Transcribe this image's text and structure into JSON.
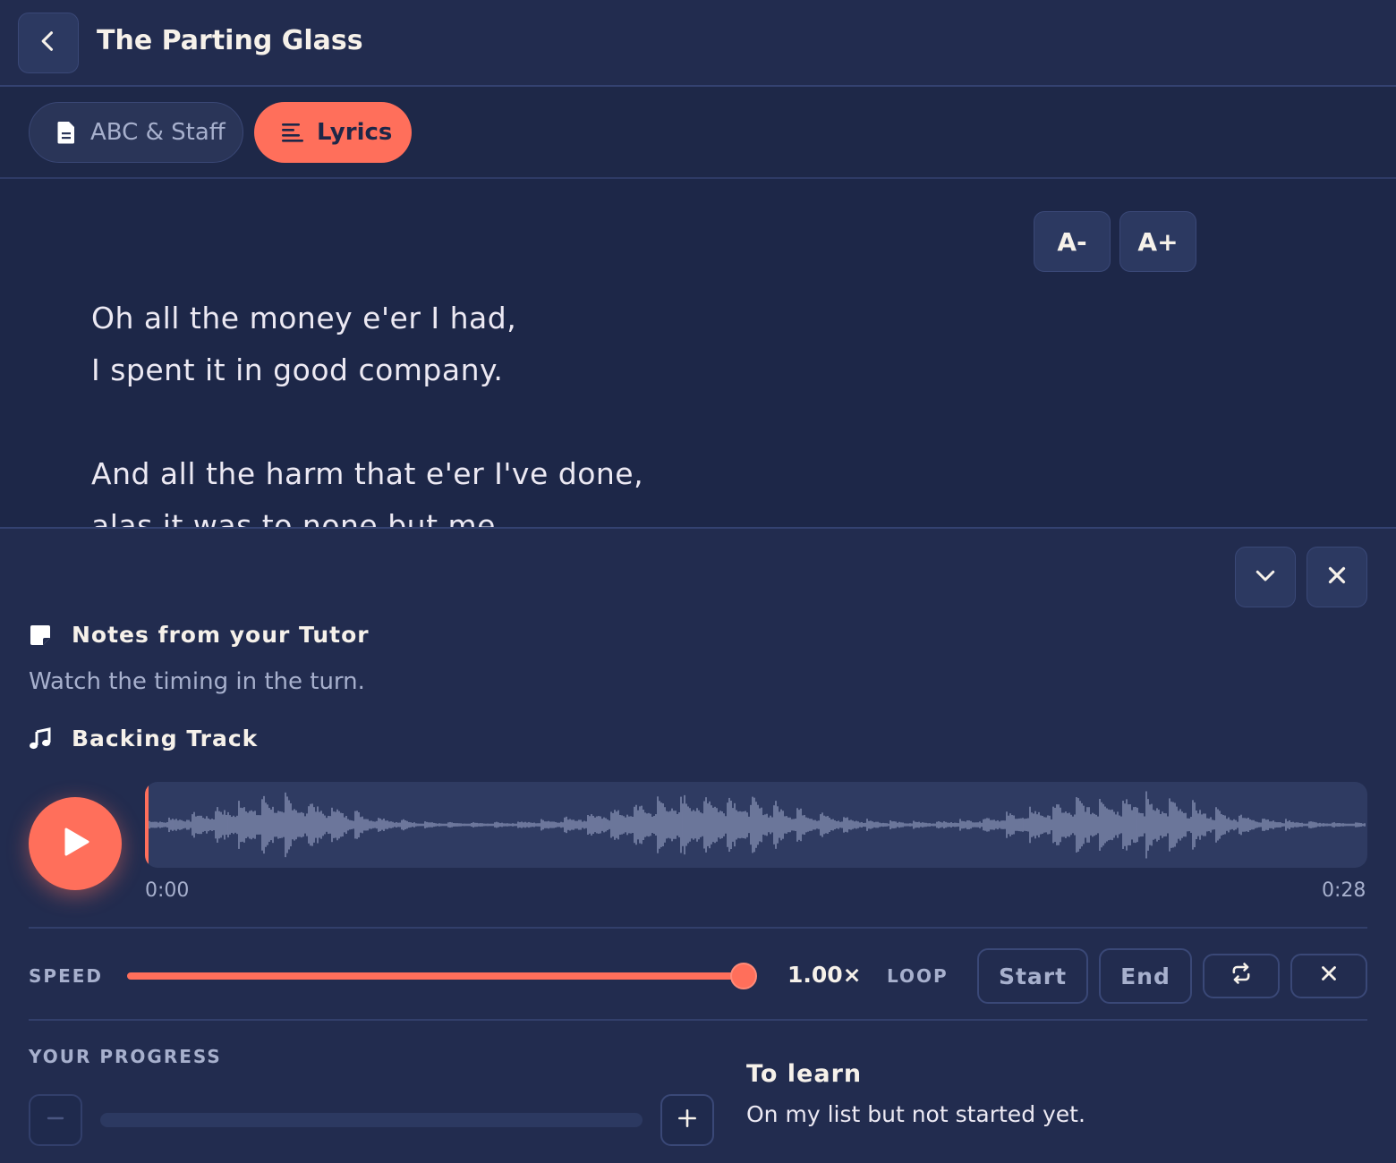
{
  "header": {
    "title": "The Parting Glass"
  },
  "tabs": [
    {
      "label": "ABC & Staff",
      "icon": "document-icon",
      "active": false
    },
    {
      "label": "Lyrics",
      "icon": "lines-icon",
      "active": true
    }
  ],
  "font_controls": {
    "decrease_label": "A-",
    "increase_label": "A+"
  },
  "lyrics": [
    "Oh all the money e'er I had,",
    "I spent it in good company.",
    "",
    "And all the harm that e'er I've done,",
    "alas it was to none but me."
  ],
  "notes": {
    "heading": "Notes from your Tutor",
    "text": "Watch the timing in the turn."
  },
  "backing_track": {
    "heading": "Backing Track",
    "current_time": "0:00",
    "duration": "0:28",
    "playhead_fraction": 0
  },
  "speed": {
    "label": "SPEED",
    "value_label": "1.00×",
    "value": 1.0,
    "slider_fraction": 1.0
  },
  "loop": {
    "label": "LOOP",
    "start_label": "Start",
    "end_label": "End"
  },
  "progress": {
    "label": "YOUR PROGRESS",
    "fraction": 0,
    "status_title": "To learn",
    "status_description": "On my list but not started yet."
  },
  "colors": {
    "accent": "#ff6f5b",
    "background": "#1d2748",
    "panel": "#222c4f",
    "muted_text": "#a7b0cd",
    "waveform": "#9fa9cc"
  }
}
